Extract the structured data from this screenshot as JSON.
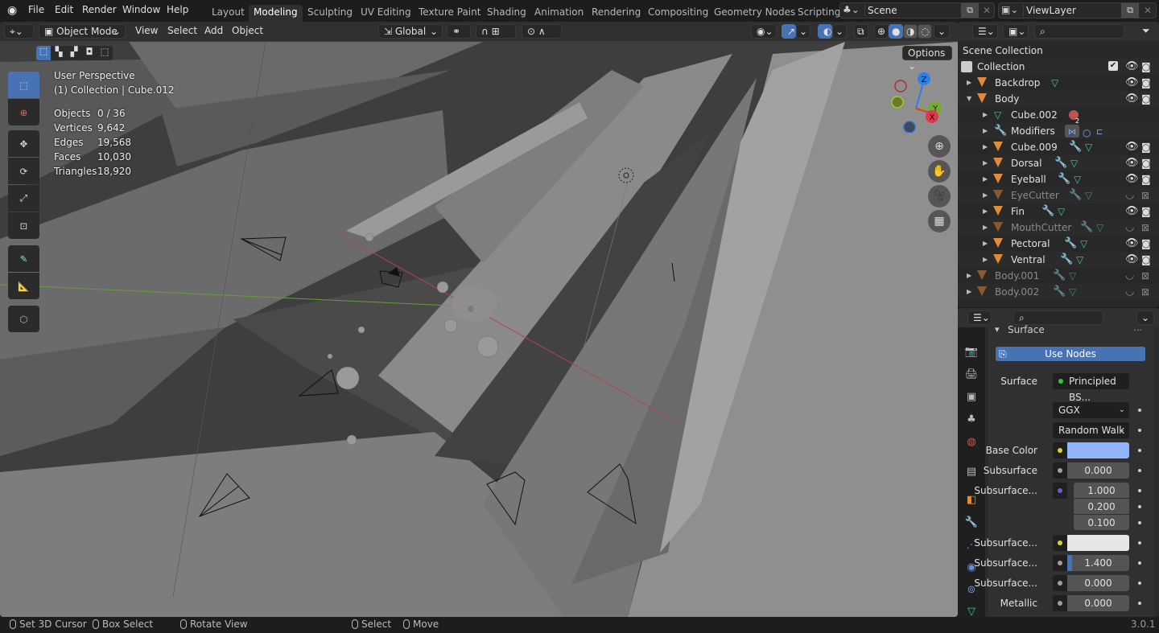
{
  "topbar": {
    "menus": [
      "File",
      "Edit",
      "Render",
      "Window",
      "Help"
    ],
    "workspaces": [
      "Layout",
      "Modeling",
      "Sculpting",
      "UV Editing",
      "Texture Paint",
      "Shading",
      "Animation",
      "Rendering",
      "Compositing",
      "Geometry Nodes",
      "Scripting"
    ],
    "active_workspace": "Modeling",
    "scene": "Scene",
    "view_layer": "ViewLayer"
  },
  "viewport": {
    "header": {
      "mode": "Object Mode",
      "menus": [
        "View",
        "Select",
        "Add",
        "Object"
      ],
      "orientation": "Global",
      "options_label": "Options"
    },
    "overlay": {
      "perspective": "User Perspective",
      "collection_info": "(1) Collection | Cube.012",
      "stats": [
        {
          "label": "Objects",
          "value": "0 / 36"
        },
        {
          "label": "Vertices",
          "value": "9,642"
        },
        {
          "label": "Edges",
          "value": "19,568"
        },
        {
          "label": "Faces",
          "value": "10,030"
        },
        {
          "label": "Triangles",
          "value": "18,920"
        }
      ]
    },
    "gizmo": {
      "z": "Z",
      "y": "Y",
      "x": "X"
    }
  },
  "outliner": {
    "title": "Scene Collection",
    "rows": [
      {
        "label": "Collection",
        "type": "collection"
      },
      {
        "label": "Backdrop",
        "type": "object"
      },
      {
        "label": "Body",
        "type": "object"
      },
      {
        "label": "Cube.002",
        "type": "mesh",
        "badge": "2"
      },
      {
        "label": "Modifiers",
        "type": "modifiers"
      },
      {
        "label": "Cube.009",
        "type": "object"
      },
      {
        "label": "Dorsal",
        "type": "object"
      },
      {
        "label": "Eyeball",
        "type": "object"
      },
      {
        "label": "EyeCutter",
        "type": "object",
        "hidden": true
      },
      {
        "label": "Fin",
        "type": "object"
      },
      {
        "label": "MouthCutter",
        "type": "object",
        "hidden": true
      },
      {
        "label": "Pectoral",
        "type": "object"
      },
      {
        "label": "Ventral",
        "type": "object"
      },
      {
        "label": "Body.001",
        "type": "object",
        "hidden": true
      },
      {
        "label": "Body.002",
        "type": "object",
        "hidden": true
      }
    ]
  },
  "properties": {
    "panel_title": "Surface",
    "use_nodes_label": "Use Nodes",
    "surface_label": "Surface",
    "surface_value": "Principled BS...",
    "distribution": "GGX",
    "subsurface_method": "Random Walk",
    "fields": [
      {
        "label": "Base Color",
        "type": "color",
        "color": "#93b3fb",
        "socket": "#d4d42a"
      },
      {
        "label": "Subsurface",
        "value": "0.000",
        "socket": "#a0a0a0"
      },
      {
        "label": "Subsurface...",
        "values": [
          "1.000",
          "0.200",
          "0.100"
        ],
        "socket": "#6363c7"
      },
      {
        "label": "Subsurface...",
        "type": "color",
        "color": "#e6e6e6",
        "socket": "#d4d42a"
      },
      {
        "label": "Subsurface...",
        "value": "1.400",
        "socket": "#a0a0a0",
        "fill": 0.03
      },
      {
        "label": "Subsurface...",
        "value": "0.000",
        "socket": "#a0a0a0"
      },
      {
        "label": "Metallic",
        "value": "0.000",
        "socket": "#a0a0a0"
      }
    ]
  },
  "statusbar": {
    "items": [
      "Set 3D Cursor",
      "Box Select",
      "Rotate View",
      "Select",
      "Move"
    ],
    "version": "3.0.1"
  }
}
